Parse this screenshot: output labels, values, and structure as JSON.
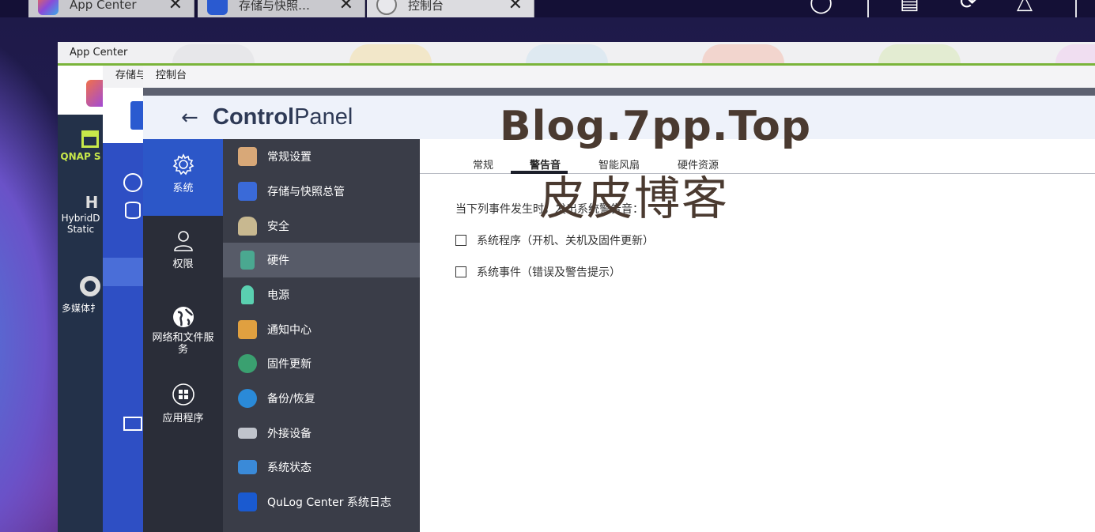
{
  "taskbar": {
    "tabs": [
      {
        "label": "App Center",
        "close": "✕"
      },
      {
        "label": "存储与快照…",
        "close": "✕"
      },
      {
        "label": "控制台",
        "close": "✕"
      }
    ]
  },
  "appcenter": {
    "title": "App Center",
    "side": [
      {
        "label": "QNAP S"
      },
      {
        "label": "HybridD Static"
      },
      {
        "label": "多媒体扌"
      }
    ]
  },
  "storage": {
    "title": "存储与"
  },
  "controlpanel": {
    "title": "控制台",
    "header_bold": "Control",
    "header_light": "Panel",
    "nav": [
      {
        "label": "系统",
        "icon": "gear-icon"
      },
      {
        "label": "权限",
        "icon": "user-icon"
      },
      {
        "label": "网络和文件服务",
        "icon": "globe-icon"
      },
      {
        "label": "应用程序",
        "icon": "apps-icon"
      }
    ],
    "sub": [
      {
        "label": "常规设置",
        "color": "#d0a070"
      },
      {
        "label": "存储与快照总管",
        "color": "#3a6ad8"
      },
      {
        "label": "安全",
        "color": "#c8b890"
      },
      {
        "label": "硬件",
        "color": "#4aa890"
      },
      {
        "label": "电源",
        "color": "#5ad0b0"
      },
      {
        "label": "通知中心",
        "color": "#e0a040"
      },
      {
        "label": "固件更新",
        "color": "#3aa070"
      },
      {
        "label": "备份/恢复",
        "color": "#2a8ad8"
      },
      {
        "label": "外接设备",
        "color": "#c0c4cc"
      },
      {
        "label": "系统状态",
        "color": "#3a8ad8"
      },
      {
        "label": "QuLog Center 系统日志",
        "color": "#1a5ad0"
      }
    ],
    "tabs": [
      "常规",
      "警告音",
      "智能风扇",
      "硬件资源"
    ],
    "active_tab": "警告音",
    "description": "当下列事件发生时，发出系统警告音：",
    "options": [
      {
        "label": "系统程序（开机、关机及固件更新）",
        "checked": false
      },
      {
        "label": "系统事件（错误及警告提示）",
        "checked": false
      }
    ]
  },
  "watermark": {
    "line1": "Blog.7pp.Top",
    "line2": "皮皮博客"
  }
}
